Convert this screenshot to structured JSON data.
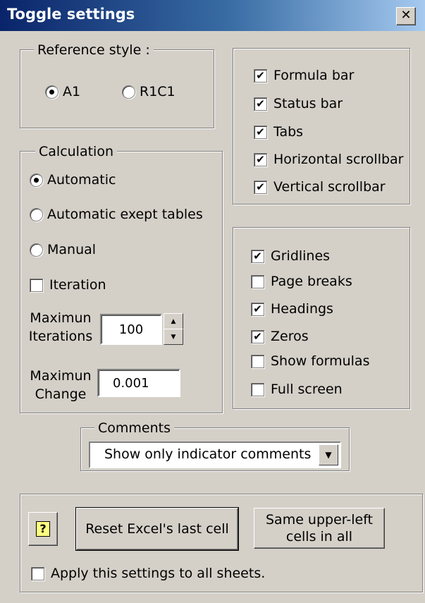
{
  "window": {
    "title": "Toggle settings",
    "close_glyph": "✕"
  },
  "reference_style": {
    "legend": "Reference style :",
    "options": [
      {
        "label": "A1",
        "selected": true
      },
      {
        "label": "R1C1",
        "selected": false
      }
    ]
  },
  "view_options": [
    {
      "label": "Formula bar",
      "checked": true
    },
    {
      "label": "Status bar",
      "checked": true
    },
    {
      "label": "Tabs",
      "checked": true
    },
    {
      "label": "Horizontal scrollbar",
      "checked": true
    },
    {
      "label": "Vertical scrollbar",
      "checked": true
    }
  ],
  "calculation": {
    "legend": "Calculation",
    "modes": [
      {
        "label": "Automatic",
        "selected": true
      },
      {
        "label": "Automatic exept tables",
        "selected": false
      },
      {
        "label": "Manual",
        "selected": false
      }
    ],
    "iteration": {
      "label": "Iteration",
      "checked": false
    },
    "max_iterations": {
      "label_line1": "Maximun",
      "label_line2": "Iterations",
      "value": "100"
    },
    "max_change": {
      "label_line1": "Maximun",
      "label_line2": "Change",
      "value": "0.001"
    }
  },
  "display_options": [
    {
      "label": "Gridlines",
      "checked": true
    },
    {
      "label": "Page breaks",
      "checked": false
    },
    {
      "label": "Headings",
      "checked": true
    },
    {
      "label": "Zeros",
      "checked": true
    },
    {
      "label": "Show formulas",
      "checked": false
    },
    {
      "label": "Full screen",
      "checked": false
    }
  ],
  "comments": {
    "legend": "Comments",
    "selected": "Show only indicator comments"
  },
  "buttons": {
    "help": "?",
    "reset": "Reset Excel's last cell",
    "same_line1": "Same upper-left",
    "same_line2": "cells in all"
  },
  "apply_all": {
    "label": "Apply this settings to all sheets.",
    "checked": false
  },
  "check_glyph": "✔"
}
